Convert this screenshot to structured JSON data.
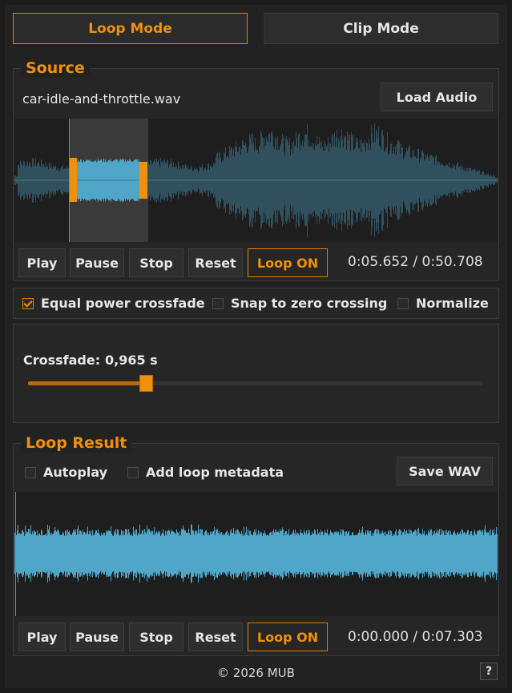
{
  "modes": {
    "loop": "Loop Mode",
    "clip": "Clip Mode"
  },
  "source": {
    "title": "Source",
    "filename": "car-idle-and-throttle.wav",
    "load_label": "Load Audio",
    "transport": {
      "play": "Play",
      "pause": "Pause",
      "stop": "Stop",
      "reset": "Reset",
      "loop": "Loop ON"
    },
    "time": "0:05.652 / 0:50.708"
  },
  "options": {
    "equal_power": {
      "label": "Equal power crossfade",
      "checked": true
    },
    "snap_zero": {
      "label": "Snap to zero crossing",
      "checked": false
    },
    "normalize": {
      "label": "Normalize",
      "checked": false
    }
  },
  "crossfade": {
    "label": "Crossfade:",
    "value_text": "0,965 s",
    "fraction": 0.258
  },
  "result": {
    "title": "Loop Result",
    "autoplay": {
      "label": "Autoplay",
      "checked": false
    },
    "metadata": {
      "label": "Add loop metadata",
      "checked": false
    },
    "save_label": "Save WAV",
    "transport": {
      "play": "Play",
      "pause": "Pause",
      "stop": "Stop",
      "reset": "Reset",
      "loop": "Loop ON"
    },
    "time": "0:00.000 / 0:07.303"
  },
  "footer": {
    "copyright": "© 2026 MUB",
    "help": "?"
  },
  "colors": {
    "accent": "#f0900f",
    "wave_dim": "#30505e",
    "wave_bright": "#4fa6c8",
    "playhead": "#e06060"
  }
}
